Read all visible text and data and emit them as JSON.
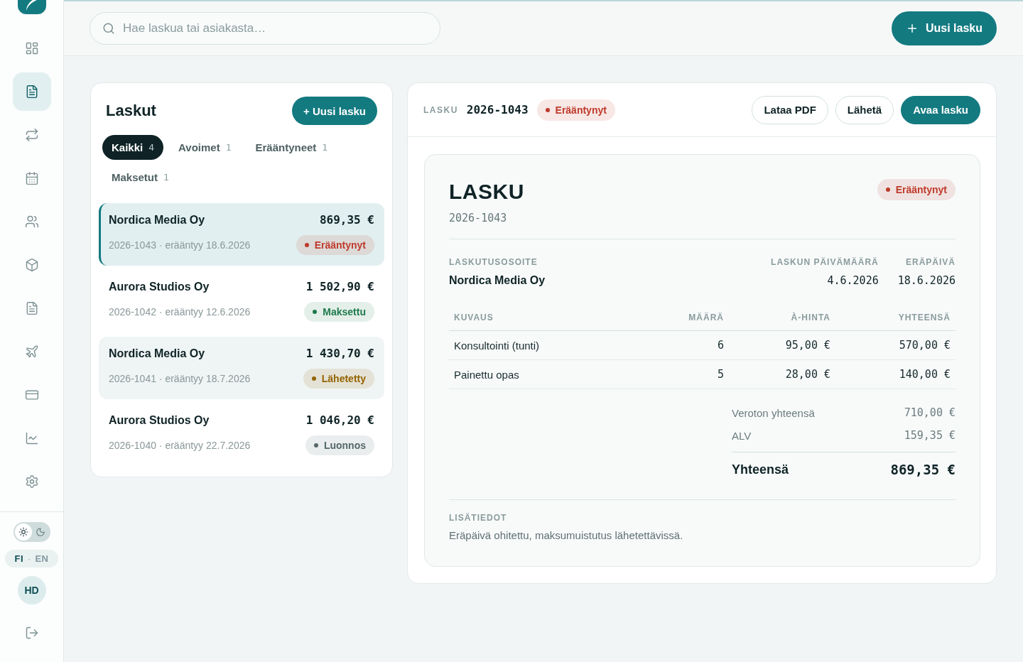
{
  "sidebar": {
    "nav_items": [
      {
        "selected": false
      },
      {
        "selected": true
      },
      {
        "selected": false
      },
      {
        "selected": false
      },
      {
        "selected": false
      },
      {
        "selected": false
      },
      {
        "selected": false
      },
      {
        "selected": false
      },
      {
        "selected": false
      },
      {
        "selected": false
      },
      {
        "selected": false
      }
    ],
    "theme_toggle": {
      "dark": false
    },
    "language": {
      "options": [
        {
          "label": "FI",
          "selected": true
        },
        {
          "label": "EN",
          "selected": false
        }
      ],
      "separator": "·"
    },
    "user": {
      "initials": "HD"
    }
  },
  "top_bar": {
    "search": {
      "placeholder": "Hae laskua tai asiakasta…"
    },
    "new_invoice_button": {
      "label": "Uusi lasku"
    }
  },
  "invoice_list": {
    "title": "Laskut",
    "new_button": {
      "label": "+ Uusi lasku"
    },
    "filters": [
      {
        "label": "Kaikki",
        "count": "4",
        "selected": true
      },
      {
        "label": "Avoimet",
        "count": "1",
        "selected": false
      },
      {
        "label": "Erääntyneet",
        "count": "1",
        "selected": false
      },
      {
        "label": "Maksetut",
        "count": "1",
        "selected": false
      }
    ],
    "items": [
      {
        "customer": "Nordica Media Oy",
        "amount": "869,35 €",
        "meta": "2026-1043 · erääntyy 18.6.2026",
        "status": {
          "label": "Erääntynyt",
          "color": "#bf3a2b"
        },
        "selected": true,
        "hovered": false
      },
      {
        "customer": "Aurora Studios Oy",
        "amount": "1 502,90 €",
        "meta": "2026-1042 · erääntyy 12.6.2026",
        "status": {
          "label": "Maksettu",
          "color": "#1e7a4c"
        },
        "selected": false,
        "hovered": false
      },
      {
        "customer": "Nordica Media Oy",
        "amount": "1 430,70 €",
        "meta": "2026-1041 · erääntyy 18.7.2026",
        "status": {
          "label": "Lähetetty",
          "color": "#946300"
        },
        "selected": false,
        "hovered": true
      },
      {
        "customer": "Aurora Studios Oy",
        "amount": "1 046,20 €",
        "meta": "2026-1040 · erääntyy 22.7.2026",
        "status": {
          "label": "Luonnos",
          "color": "#55686a"
        },
        "selected": false,
        "hovered": false
      }
    ]
  },
  "invoice_detail": {
    "header": {
      "label": "LASKU",
      "number": "2026-1043",
      "status": {
        "label": "Erääntynyt",
        "color": "#bf3a2b"
      }
    },
    "actions": [
      {
        "label": "Lataa PDF",
        "kind": "secondary"
      },
      {
        "label": "Lähetä",
        "kind": "secondary"
      },
      {
        "label": "Avaa lasku",
        "kind": "primary"
      }
    ],
    "document": {
      "title": "LASKU",
      "status": {
        "label": "Erääntynyt",
        "color": "#bf3a2b"
      },
      "number": "2026-1043",
      "billing": {
        "label": "LASKUTUSOSOITE",
        "value": "Nordica Media Oy"
      },
      "dates": [
        {
          "label": "LASKUN PÄIVÄMÄÄRÄ",
          "value": "4.6.2026"
        },
        {
          "label": "ERÄPÄIVÄ",
          "value": "18.6.2026"
        }
      ],
      "table": {
        "columns": [
          "KUVAUS",
          "MÄÄRÄ",
          "À-HINTA",
          "YHTEENSÄ"
        ],
        "rows": [
          [
            "Konsultointi (tunti)",
            "6",
            "95,00 €",
            "570,00 €"
          ],
          [
            "Painettu opas",
            "5",
            "28,00 €",
            "140,00 €"
          ]
        ]
      },
      "totals": [
        {
          "label": "Veroton yhteensä",
          "value": "710,00 €",
          "kind": "subtotal"
        },
        {
          "label": "ALV",
          "value": "159,35 €",
          "kind": "subtotal"
        },
        {
          "label": "Yhteensä",
          "value": "869,35 €",
          "kind": "total"
        }
      ],
      "notes": {
        "label": "LISÄTIEDOT",
        "text": "Eräpäivä ohitettu, maksumuistutus lähetettävissä."
      }
    }
  }
}
